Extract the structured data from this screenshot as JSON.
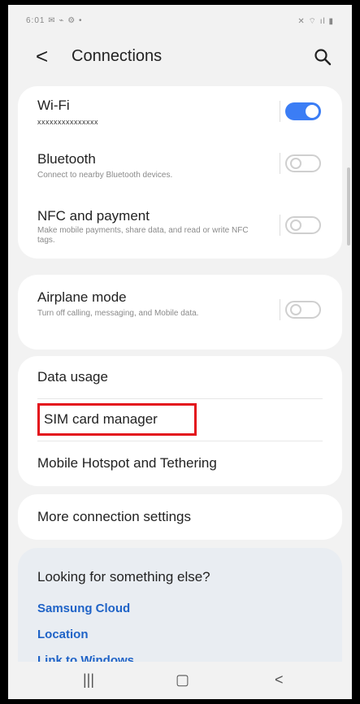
{
  "status_bar": {
    "left": "6:01 ✉ ⌁ ⚙ •",
    "right": "✕ ⌔ ıl ▮"
  },
  "header": {
    "title": "Connections",
    "back_glyph": "<"
  },
  "group1": {
    "wifi": {
      "label": "Wi-Fi",
      "network": "xxxxxxxxxxxxxxx",
      "state": "on"
    },
    "bluetooth": {
      "label": "Bluetooth",
      "desc": "Connect to nearby Bluetooth devices.",
      "state": "off"
    },
    "nfc": {
      "label": "NFC and payment",
      "desc": "Make mobile payments, share data, and read or write NFC tags.",
      "state": "off"
    }
  },
  "group2": {
    "airplane": {
      "label": "Airplane mode",
      "desc": "Turn off calling, messaging, and Mobile data.",
      "state": "off"
    }
  },
  "group3": {
    "items": [
      "Data usage",
      "SIM card manager",
      "Mobile Hotspot and Tethering"
    ],
    "highlighted_item": "SIM card manager"
  },
  "group4": {
    "more": "More connection settings"
  },
  "looking": {
    "heading": "Looking for something else?",
    "links": [
      "Samsung Cloud",
      "Location",
      "Link to Windows"
    ]
  },
  "navbar": {
    "recents": "|||",
    "home": "▢",
    "back": "<"
  },
  "colors": {
    "accent": "#3b7df5",
    "link": "#1f63c7",
    "highlight": "#e3111b"
  },
  "icons": {
    "search": "search-icon"
  }
}
